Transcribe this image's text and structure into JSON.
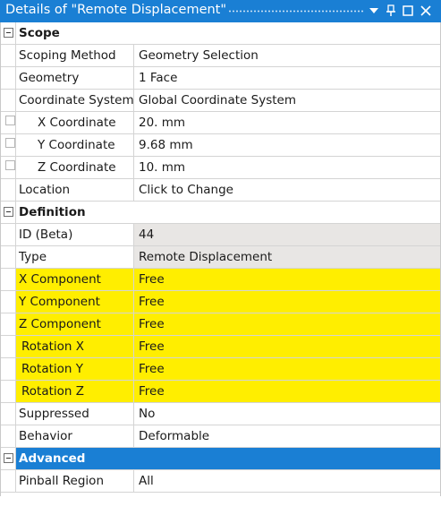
{
  "window": {
    "title": "Details of \"Remote Displacement\"",
    "accent": "#1a7fd4",
    "highlight": "#ffee00"
  },
  "scope": {
    "label": "Scope",
    "rows": [
      {
        "name": "Scoping Method",
        "value": "Geometry Selection"
      },
      {
        "name": "Geometry",
        "value": "1 Face"
      },
      {
        "name": "Coordinate System",
        "value": "Global Coordinate System"
      },
      {
        "name": "X Coordinate",
        "value": "20. mm"
      },
      {
        "name": "Y Coordinate",
        "value": "9.68 mm"
      },
      {
        "name": "Z Coordinate",
        "value": "10. mm"
      },
      {
        "name": "Location",
        "value": "Click to Change"
      }
    ]
  },
  "definition": {
    "label": "Definition",
    "rows": [
      {
        "name": "ID (Beta)",
        "value": "44"
      },
      {
        "name": "Type",
        "value": "Remote Displacement"
      },
      {
        "name": "X Component",
        "value": "Free"
      },
      {
        "name": "Y Component",
        "value": "Free"
      },
      {
        "name": "Z Component",
        "value": "Free"
      },
      {
        "name": "Rotation X",
        "value": "Free"
      },
      {
        "name": "Rotation Y",
        "value": "Free"
      },
      {
        "name": "Rotation Z",
        "value": "Free"
      },
      {
        "name": "Suppressed",
        "value": "No"
      },
      {
        "name": "Behavior",
        "value": "Deformable"
      }
    ]
  },
  "advanced": {
    "label": "Advanced",
    "rows": [
      {
        "name": "Pinball Region",
        "value": "All"
      }
    ]
  }
}
